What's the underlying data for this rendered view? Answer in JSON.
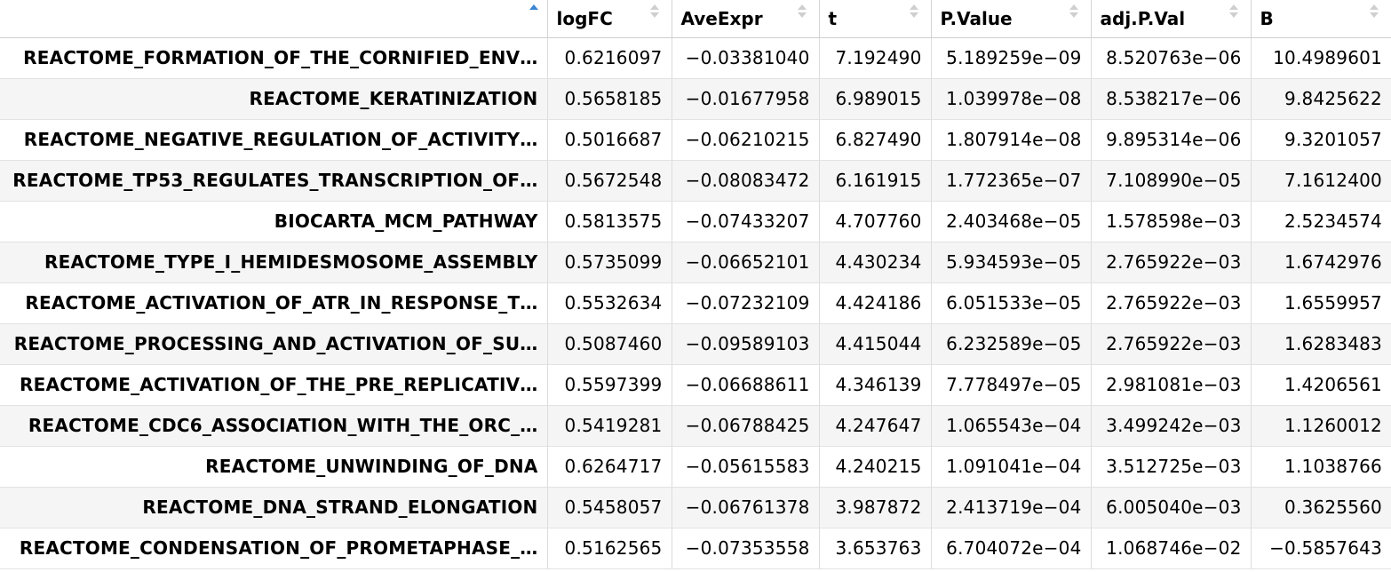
{
  "table": {
    "sort_indicator": "ascending",
    "columns": [
      {
        "label": ""
      },
      {
        "label": "logFC"
      },
      {
        "label": "AveExpr"
      },
      {
        "label": "t"
      },
      {
        "label": "P.Value"
      },
      {
        "label": "adj.P.Val"
      },
      {
        "label": "B"
      }
    ],
    "rows": [
      {
        "name": "REACTOME_FORMATION_OF_THE_CORNIFIED_ENVELOPE",
        "display": "REACTOME_FORMATION_OF_THE_CORNIFIED_ENV…",
        "logFC": "0.6216097",
        "AveExpr": "−0.03381040",
        "t": "7.192490",
        "P_Value": "5.189259e−09",
        "adj_P_Val": "8.520763e−06",
        "B": "10.4989601"
      },
      {
        "name": "REACTOME_KERATINIZATION",
        "display": "REACTOME_KERATINIZATION",
        "logFC": "0.5658185",
        "AveExpr": "−0.01677958",
        "t": "6.989015",
        "P_Value": "1.039978e−08",
        "adj_P_Val": "8.538217e−06",
        "B": "9.8425622"
      },
      {
        "name": "REACTOME_NEGATIVE_REGULATION_OF_ACTIVITY",
        "display": "REACTOME_NEGATIVE_REGULATION_OF_ACTIVITY…",
        "logFC": "0.5016687",
        "AveExpr": "−0.06210215",
        "t": "6.827490",
        "P_Value": "1.807914e−08",
        "adj_P_Val": "9.895314e−06",
        "B": "9.3201057"
      },
      {
        "name": "REACTOME_TP53_REGULATES_TRANSCRIPTION_OF",
        "display": "REACTOME_TP53_REGULATES_TRANSCRIPTION_OF…",
        "logFC": "0.5672548",
        "AveExpr": "−0.08083472",
        "t": "6.161915",
        "P_Value": "1.772365e−07",
        "adj_P_Val": "7.108990e−05",
        "B": "7.1612400"
      },
      {
        "name": "BIOCARTA_MCM_PATHWAY",
        "display": "BIOCARTA_MCM_PATHWAY",
        "logFC": "0.5813575",
        "AveExpr": "−0.07433207",
        "t": "4.707760",
        "P_Value": "2.403468e−05",
        "adj_P_Val": "1.578598e−03",
        "B": "2.5234574"
      },
      {
        "name": "REACTOME_TYPE_I_HEMIDESMOSOME_ASSEMBLY",
        "display": "REACTOME_TYPE_I_HEMIDESMOSOME_ASSEMBLY",
        "logFC": "0.5735099",
        "AveExpr": "−0.06652101",
        "t": "4.430234",
        "P_Value": "5.934593e−05",
        "adj_P_Val": "2.765922e−03",
        "B": "1.6742976"
      },
      {
        "name": "REACTOME_ACTIVATION_OF_ATR_IN_RESPONSE_T",
        "display": "REACTOME_ACTIVATION_OF_ATR_IN_RESPONSE_T…",
        "logFC": "0.5532634",
        "AveExpr": "−0.07232109",
        "t": "4.424186",
        "P_Value": "6.051533e−05",
        "adj_P_Val": "2.765922e−03",
        "B": "1.6559957"
      },
      {
        "name": "REACTOME_PROCESSING_AND_ACTIVATION_OF_SU",
        "display": "REACTOME_PROCESSING_AND_ACTIVATION_OF_SU…",
        "logFC": "0.5087460",
        "AveExpr": "−0.09589103",
        "t": "4.415044",
        "P_Value": "6.232589e−05",
        "adj_P_Val": "2.765922e−03",
        "B": "1.6283483"
      },
      {
        "name": "REACTOME_ACTIVATION_OF_THE_PRE_REPLICATIV",
        "display": "REACTOME_ACTIVATION_OF_THE_PRE_REPLICATIV…",
        "logFC": "0.5597399",
        "AveExpr": "−0.06688611",
        "t": "4.346139",
        "P_Value": "7.778497e−05",
        "adj_P_Val": "2.981081e−03",
        "B": "1.4206561"
      },
      {
        "name": "REACTOME_CDC6_ASSOCIATION_WITH_THE_ORC_",
        "display": "REACTOME_CDC6_ASSOCIATION_WITH_THE_ORC_…",
        "logFC": "0.5419281",
        "AveExpr": "−0.06788425",
        "t": "4.247647",
        "P_Value": "1.065543e−04",
        "adj_P_Val": "3.499242e−03",
        "B": "1.1260012"
      },
      {
        "name": "REACTOME_UNWINDING_OF_DNA",
        "display": "REACTOME_UNWINDING_OF_DNA",
        "logFC": "0.6264717",
        "AveExpr": "−0.05615583",
        "t": "4.240215",
        "P_Value": "1.091041e−04",
        "adj_P_Val": "3.512725e−03",
        "B": "1.1038766"
      },
      {
        "name": "REACTOME_DNA_STRAND_ELONGATION",
        "display": "REACTOME_DNA_STRAND_ELONGATION",
        "logFC": "0.5458057",
        "AveExpr": "−0.06761378",
        "t": "3.987872",
        "P_Value": "2.413719e−04",
        "adj_P_Val": "6.005040e−03",
        "B": "0.3625560"
      },
      {
        "name": "REACTOME_CONDENSATION_OF_PROMETAPHASE_",
        "display": "REACTOME_CONDENSATION_OF_PROMETAPHASE_…",
        "logFC": "0.5162565",
        "AveExpr": "−0.07353558",
        "t": "3.653763",
        "P_Value": "6.704072e−04",
        "adj_P_Val": "1.068746e−02",
        "B": "−0.5857643"
      }
    ]
  },
  "colors": {
    "sort_active": "#3a86d4",
    "sort_inactive": "#cfcfcf",
    "row_stripe": "#f5f5f5"
  }
}
